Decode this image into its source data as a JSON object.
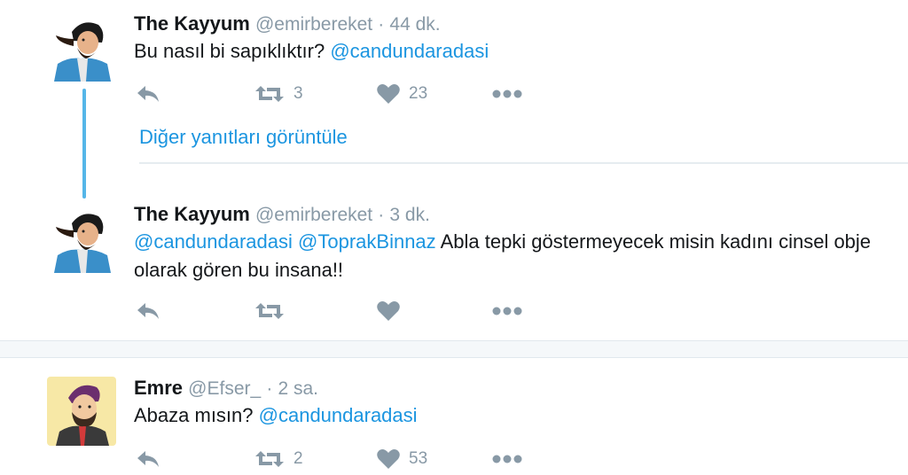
{
  "tweets": [
    {
      "name": "The Kayyum",
      "handle": "@emirbereket",
      "sep": "·",
      "time": "44 dk.",
      "text_plain": "Bu nasıl bi sapıklıktır? ",
      "mention1": "@candundaradasi",
      "retweets": "3",
      "likes": "23"
    },
    {
      "name": "The Kayyum",
      "handle": "@emirbereket",
      "sep": "·",
      "time": "3 dk.",
      "mention1": "@candundaradasi",
      "mention2": "@ToprakBinnaz",
      "text_plain": " Abla tepki göstermeyecek misin kadını cinsel obje olarak gören bu insana!!",
      "retweets": "",
      "likes": ""
    },
    {
      "name": "Emre",
      "handle": "@Efser_",
      "sep": "·",
      "time": "2 sa.",
      "text_plain": "Abaza mısın? ",
      "mention1": "@candundaradasi",
      "retweets": "2",
      "likes": "53"
    }
  ],
  "thread": {
    "more_replies_label": "Diğer yanıtları görüntüle"
  },
  "colors": {
    "link": "#1b95e0",
    "muted": "#8899a6",
    "thread_line": "#55b6e8"
  },
  "icons": [
    "reply-icon",
    "retweet-icon",
    "heart-icon",
    "more-icon"
  ]
}
